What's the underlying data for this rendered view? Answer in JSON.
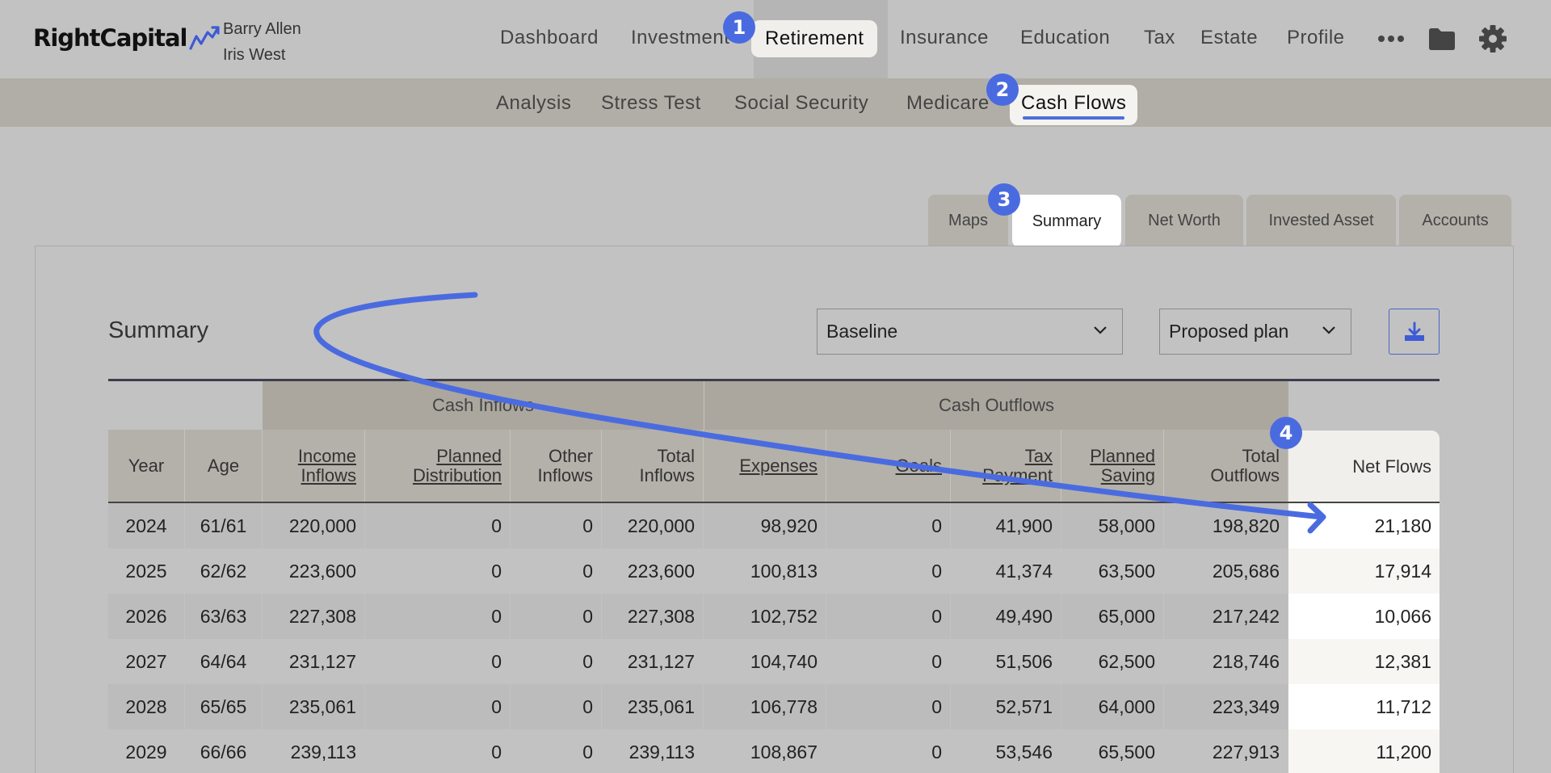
{
  "brand": {
    "name": "RightCapital"
  },
  "clients": [
    "Barry Allen",
    "Iris West"
  ],
  "main_nav": {
    "items": [
      "Dashboard",
      "Investment",
      "Retirement",
      "Insurance",
      "Education",
      "Tax",
      "Estate",
      "Profile"
    ],
    "active": "Retirement"
  },
  "sub_nav": {
    "items": [
      "Analysis",
      "Stress Test",
      "Social Security",
      "Medicare",
      "Cash Flows"
    ],
    "active": "Cash Flows"
  },
  "tabs": {
    "items": [
      "Maps",
      "Summary",
      "Net Worth",
      "Invested Asset",
      "Accounts"
    ],
    "active": "Summary"
  },
  "panel": {
    "title": "Summary",
    "select_left": "Baseline",
    "select_right": "Proposed plan"
  },
  "table": {
    "groups": [
      "Cash Inflows",
      "Cash Outflows"
    ],
    "columns": [
      {
        "label": "Year",
        "link": false
      },
      {
        "label": "Age",
        "link": false
      },
      {
        "label": "Income Inflows",
        "link": true
      },
      {
        "label": "Planned Distribution",
        "link": true
      },
      {
        "label": "Other Inflows",
        "link": false
      },
      {
        "label": "Total Inflows",
        "link": false
      },
      {
        "label": "Expenses",
        "link": true
      },
      {
        "label": "Goals",
        "link": true
      },
      {
        "label": "Tax Payment",
        "link": true
      },
      {
        "label": "Planned Saving",
        "link": true
      },
      {
        "label": "Total Outflows",
        "link": false
      },
      {
        "label": "Net Flows",
        "link": false
      }
    ],
    "rows": [
      [
        "2024",
        "61/61",
        "220,000",
        "0",
        "0",
        "220,000",
        "98,920",
        "0",
        "41,900",
        "58,000",
        "198,820",
        "21,180"
      ],
      [
        "2025",
        "62/62",
        "223,600",
        "0",
        "0",
        "223,600",
        "100,813",
        "0",
        "41,374",
        "63,500",
        "205,686",
        "17,914"
      ],
      [
        "2026",
        "63/63",
        "227,308",
        "0",
        "0",
        "227,308",
        "102,752",
        "0",
        "49,490",
        "65,000",
        "217,242",
        "10,066"
      ],
      [
        "2027",
        "64/64",
        "231,127",
        "0",
        "0",
        "231,127",
        "104,740",
        "0",
        "51,506",
        "62,500",
        "218,746",
        "12,381"
      ],
      [
        "2028",
        "65/65",
        "235,061",
        "0",
        "0",
        "235,061",
        "106,778",
        "0",
        "52,571",
        "64,000",
        "223,349",
        "11,712"
      ],
      [
        "2029",
        "66/66",
        "239,113",
        "0",
        "0",
        "239,113",
        "108,867",
        "0",
        "53,546",
        "65,500",
        "227,913",
        "11,200"
      ]
    ]
  },
  "annotations": {
    "badges": [
      "1",
      "2",
      "3",
      "4"
    ],
    "color": "#4a6be0"
  },
  "colors": {
    "accent": "#4b6edc",
    "background": "#c2c2c2",
    "header_bg": "#b4b1aa",
    "active_pill": "#f0efeb"
  }
}
